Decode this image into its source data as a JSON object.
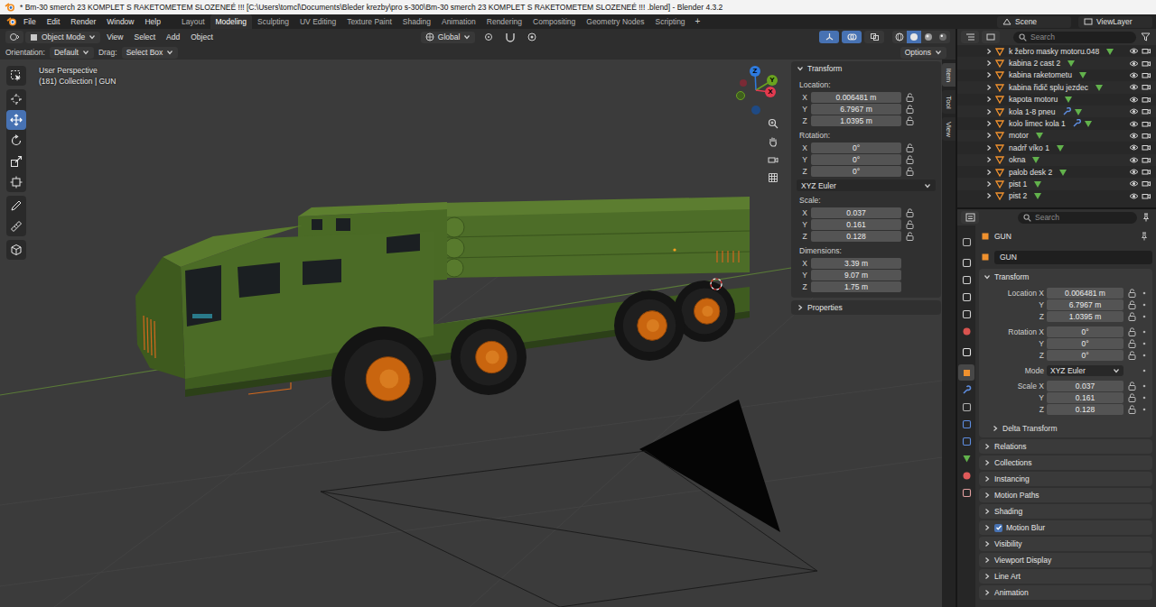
{
  "window": {
    "title": "* Bm-30 smerch 23 KOMPLET S RAKETOMETEM SLOZENEÉ !!!  [C:\\Users\\tomcl\\Documents\\Bleder krezby\\pro s-300\\Bm-30 smerch 23 KOMPLET S RAKETOMETEM SLOZENEÉ !!! .blend] - Blender 4.3.2"
  },
  "topbar": {
    "menus": [
      "File",
      "Edit",
      "Render",
      "Window",
      "Help"
    ],
    "workspaces": [
      {
        "label": "Layout",
        "selected": false
      },
      {
        "label": "Modeling",
        "selected": true
      },
      {
        "label": "Sculpting",
        "selected": false
      },
      {
        "label": "UV Editing",
        "selected": false
      },
      {
        "label": "Texture Paint",
        "selected": false
      },
      {
        "label": "Shading",
        "selected": false
      },
      {
        "label": "Animation",
        "selected": false
      },
      {
        "label": "Rendering",
        "selected": false
      },
      {
        "label": "Compositing",
        "selected": false
      },
      {
        "label": "Geometry Nodes",
        "selected": false
      },
      {
        "label": "Scripting",
        "selected": false
      }
    ],
    "add_workspace": "+",
    "scene": "Scene",
    "view_layer": "ViewLayer"
  },
  "viewport": {
    "header": {
      "mode": "Object Mode",
      "menus": [
        "View",
        "Select",
        "Add",
        "Object"
      ],
      "orientation": "Global",
      "toggles": [
        {
          "kind": "gizmos",
          "on": true
        },
        {
          "kind": "overlays",
          "on": true
        },
        {
          "kind": "xray",
          "on": false
        }
      ],
      "shading": [
        {
          "kind": "wireframe",
          "selected": false
        },
        {
          "kind": "solid",
          "selected": true
        },
        {
          "kind": "material",
          "selected": false
        },
        {
          "kind": "rendered",
          "selected": false
        }
      ]
    },
    "tool_settings": {
      "orientation_label": "Orientation:",
      "orientation": "Default",
      "drag_label": "Drag:",
      "drag": "Select Box",
      "options": "Options"
    },
    "overlay": {
      "view_name": "User Perspective",
      "info": "(181) Collection | GUN"
    },
    "toolbar": [
      {
        "tools": [
          {
            "kind": "select",
            "selected": false
          }
        ]
      },
      {
        "tools": [
          {
            "kind": "cursor",
            "selected": false
          },
          {
            "kind": "move",
            "selected": true
          },
          {
            "kind": "rotate",
            "selected": false
          },
          {
            "kind": "scale",
            "selected": false
          },
          {
            "kind": "transform",
            "selected": false
          }
        ]
      },
      {
        "tools": [
          {
            "kind": "annotate",
            "selected": false
          },
          {
            "kind": "measure",
            "selected": false
          }
        ]
      },
      {
        "tools": [
          {
            "kind": "add-cube",
            "selected": false
          }
        ]
      }
    ],
    "gizmo": [
      {
        "label": "Z",
        "color": "#2e7be0"
      },
      {
        "label": "Y",
        "color": "#6aa31f"
      },
      {
        "label": "X",
        "color": "#e33a4f"
      }
    ],
    "sidebar": {
      "tabs": [
        {
          "label": "Item",
          "selected": true
        },
        {
          "label": "Tool",
          "selected": false
        },
        {
          "label": "View",
          "selected": false
        }
      ],
      "panel": {
        "title": "Transform",
        "expanded": true
      },
      "items": [
        {
          "kind": "vector",
          "label": "Location:",
          "lockable": true,
          "fields": [
            {
              "axis": "X",
              "value": "0.006481 m"
            },
            {
              "axis": "Y",
              "value": "6.7967 m"
            },
            {
              "axis": "Z",
              "value": "1.0395 m"
            }
          ]
        },
        {
          "kind": "vector",
          "label": "Rotation:",
          "lockable": true,
          "fields": [
            {
              "axis": "X",
              "value": "0°"
            },
            {
              "axis": "Y",
              "value": "0°"
            },
            {
              "axis": "Z",
              "value": "0°"
            }
          ]
        },
        {
          "kind": "dropdown",
          "value": "XYZ Euler"
        },
        {
          "kind": "vector",
          "label": "Scale:",
          "lockable": true,
          "fields": [
            {
              "axis": "X",
              "value": "0.037"
            },
            {
              "axis": "Y",
              "value": "0.161"
            },
            {
              "axis": "Z",
              "value": "0.128"
            }
          ]
        },
        {
          "kind": "vector",
          "label": "Dimensions:",
          "lockable": false,
          "fields": [
            {
              "axis": "X",
              "value": "3.39 m"
            },
            {
              "axis": "Y",
              "value": "9.07 m"
            },
            {
              "axis": "Z",
              "value": "1.75 m"
            }
          ]
        }
      ],
      "collapsed": [
        {
          "title": "Properties",
          "expanded": false
        }
      ]
    }
  },
  "outliner": {
    "search": {
      "placeholder": "Search"
    },
    "rows": [
      {
        "name": "k žebro masky motoru.048",
        "expanded": false,
        "modifier": false,
        "visible": true,
        "renderable": true
      },
      {
        "name": "kabina 2 cast 2",
        "expanded": false,
        "modifier": false,
        "visible": true,
        "renderable": true
      },
      {
        "name": "kabina raketometu",
        "expanded": false,
        "modifier": false,
        "visible": true,
        "renderable": true
      },
      {
        "name": "kabina řidič splu jezdec",
        "expanded": false,
        "modifier": false,
        "visible": true,
        "renderable": true
      },
      {
        "name": "kapota motoru",
        "expanded": false,
        "modifier": false,
        "visible": true,
        "renderable": true
      },
      {
        "name": "kola 1-8 pneu",
        "expanded": false,
        "modifier": true,
        "visible": true,
        "renderable": true
      },
      {
        "name": "kolo limec kola 1",
        "expanded": false,
        "modifier": true,
        "visible": true,
        "renderable": true
      },
      {
        "name": "motor",
        "expanded": false,
        "modifier": false,
        "visible": true,
        "renderable": true
      },
      {
        "name": "nadrř víko 1",
        "expanded": false,
        "modifier": false,
        "visible": true,
        "renderable": true
      },
      {
        "name": "okna",
        "expanded": false,
        "modifier": false,
        "visible": true,
        "renderable": true
      },
      {
        "name": "palob desk 2",
        "expanded": false,
        "modifier": false,
        "visible": true,
        "renderable": true
      },
      {
        "name": "pist 1",
        "expanded": false,
        "modifier": false,
        "visible": true,
        "renderable": true
      },
      {
        "name": "pist 2",
        "expanded": false,
        "modifier": false,
        "visible": true,
        "renderable": true
      }
    ]
  },
  "properties": {
    "search": {
      "placeholder": "Search"
    },
    "tabs": [
      {
        "kind": "tool",
        "selected": false
      },
      {
        "kind": "render",
        "selected": false
      },
      {
        "kind": "output",
        "selected": false
      },
      {
        "kind": "view-layer",
        "selected": false
      },
      {
        "kind": "scene",
        "selected": false
      },
      {
        "kind": "world",
        "selected": false
      },
      {
        "kind": "collection",
        "selected": false
      },
      {
        "kind": "object",
        "selected": true
      },
      {
        "kind": "modifiers",
        "selected": false
      },
      {
        "kind": "particles",
        "selected": false
      },
      {
        "kind": "physics",
        "selected": false
      },
      {
        "kind": "constraints",
        "selected": false
      },
      {
        "kind": "data",
        "selected": false
      },
      {
        "kind": "material",
        "selected": false
      },
      {
        "kind": "texture",
        "selected": false
      }
    ],
    "context": "GUN",
    "name": "GUN",
    "transform": {
      "title": "Transform",
      "expanded": true,
      "groups": [
        {
          "rows": [
            {
              "kind": "number",
              "label": "Location X",
              "value": "0.006481 m"
            },
            {
              "kind": "number",
              "label": "Y",
              "value": "6.7967 m"
            },
            {
              "kind": "number",
              "label": "Z",
              "value": "1.0395 m"
            }
          ]
        },
        {
          "rows": [
            {
              "kind": "number",
              "label": "Rotation X",
              "value": "0°"
            },
            {
              "kind": "number",
              "label": "Y",
              "value": "0°"
            },
            {
              "kind": "number",
              "label": "Z",
              "value": "0°"
            }
          ]
        },
        {
          "rows": [
            {
              "kind": "dropdown",
              "label": "Mode",
              "value": "XYZ Euler"
            }
          ]
        },
        {
          "rows": [
            {
              "kind": "number",
              "label": "Scale X",
              "value": "0.037"
            },
            {
              "kind": "number",
              "label": "Y",
              "value": "0.161"
            },
            {
              "kind": "number",
              "label": "Z",
              "value": "0.128"
            }
          ]
        }
      ],
      "subpanel": {
        "title": "Delta Transform",
        "expanded": false
      }
    },
    "panels": [
      {
        "title": "Relations",
        "expanded": false,
        "has_checkbox": false,
        "checked": false
      },
      {
        "title": "Collections",
        "expanded": false,
        "has_checkbox": false,
        "checked": false
      },
      {
        "title": "Instancing",
        "expanded": false,
        "has_checkbox": false,
        "checked": false
      },
      {
        "title": "Motion Paths",
        "expanded": false,
        "has_checkbox": false,
        "checked": false
      },
      {
        "title": "Shading",
        "expanded": false,
        "has_checkbox": false,
        "checked": false
      },
      {
        "title": "Motion Blur",
        "expanded": false,
        "has_checkbox": true,
        "checked": true
      },
      {
        "title": "Visibility",
        "expanded": false,
        "has_checkbox": false,
        "checked": false
      },
      {
        "title": "Viewport Display",
        "expanded": false,
        "has_checkbox": false,
        "checked": false
      },
      {
        "title": "Line Art",
        "expanded": false,
        "has_checkbox": false,
        "checked": false
      },
      {
        "title": "Animation",
        "expanded": false,
        "has_checkbox": false,
        "checked": false
      }
    ]
  }
}
